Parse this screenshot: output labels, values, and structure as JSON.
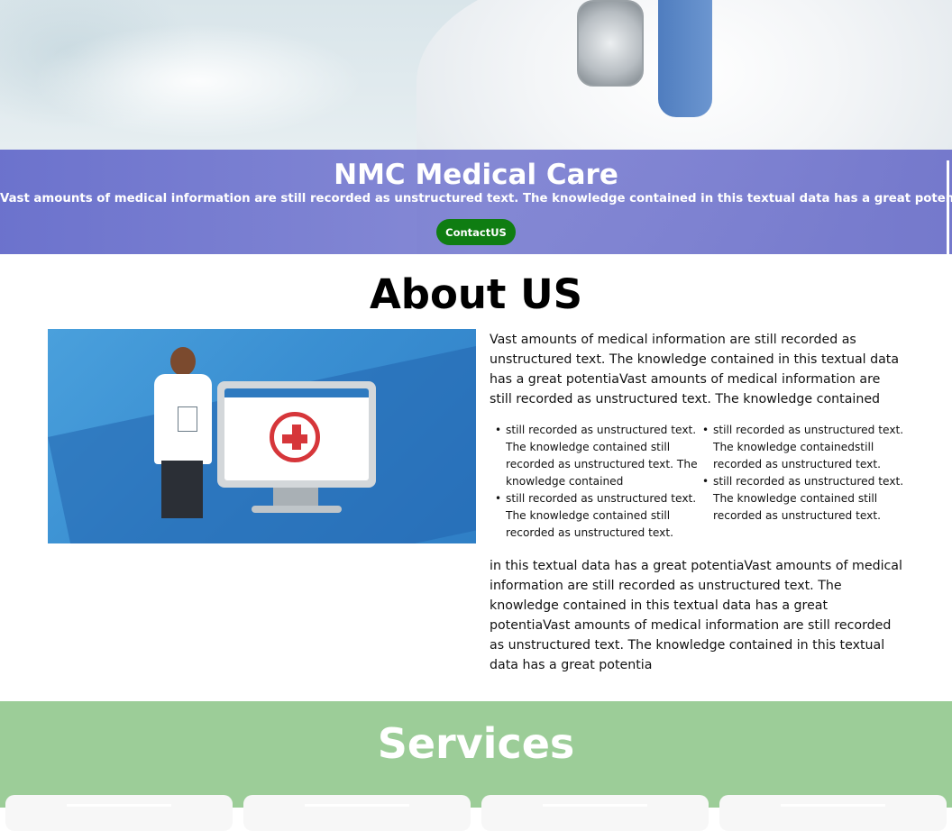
{
  "hero": {
    "title": "NMC Medical Care",
    "subtitle": "Vast amounts of medical information are still recorded as unstructured text. The knowledge contained in this textual data has a great potentia",
    "contact_label": "ContactUS"
  },
  "about": {
    "title": "About US",
    "image_icon": "doctor-computer-illustration",
    "intro": "Vast amounts of medical information are still recorded as unstructured text. The knowledge contained in this textual data has a great potentiaVast amounts of medical information are still recorded as unstructured text. The knowledge contained",
    "bullets_left": [
      "still recorded as unstructured text. The knowledge contained still recorded as unstructured text. The knowledge contained",
      "still recorded as unstructured text. The knowledge contained still recorded as unstructured text."
    ],
    "bullets_right": [
      "still recorded as unstructured text. The knowledge containedstill recorded as unstructured text.",
      "still recorded as unstructured text. The knowledge contained still recorded as unstructured text."
    ],
    "outro": "in this textual data has a great potentiaVast amounts of medical information are still recorded as unstructured text. The knowledge contained in this textual data has a great potentiaVast amounts of medical information are still recorded as unstructured text. The knowledge contained in this textual data has a great potentia"
  },
  "services": {
    "title": "Services",
    "card_count": 4
  },
  "colors": {
    "hero_band": "#6a6ecb",
    "contact_button": "#0f7d12",
    "services_bg": "#9ccd98",
    "image_bg": "#3a8fd2"
  }
}
